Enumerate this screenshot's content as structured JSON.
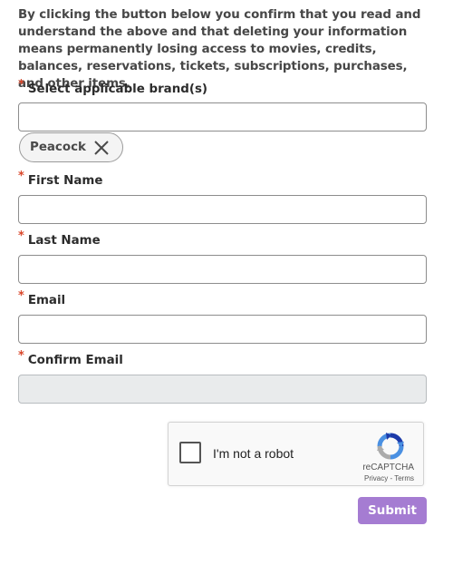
{
  "consent_text": "By clicking the button below you confirm that you read and understand the above and that deleting your information means permanently losing access to movies, credits, balances, reservations, tickets, subscriptions, purchases, and other items.",
  "required_marker": "*",
  "brand_field": {
    "label": "Select applicable brand(s)",
    "value": "",
    "selected_chips": [
      "Peacock"
    ]
  },
  "first_name": {
    "label": "First Name",
    "value": ""
  },
  "last_name": {
    "label": "Last Name",
    "value": ""
  },
  "email": {
    "label": "Email",
    "value": ""
  },
  "confirm_email": {
    "label": "Confirm Email",
    "value": "",
    "disabled": true
  },
  "recaptcha": {
    "checkbox_label": "I'm not a robot",
    "brand": "reCAPTCHA",
    "privacy": "Privacy",
    "separator": " - ",
    "terms": "Terms"
  },
  "submit_label": "Submit",
  "colors": {
    "required": "#d9472b",
    "submit_bg": "#a57cd2",
    "disabled_field_bg": "#e9ebec"
  }
}
